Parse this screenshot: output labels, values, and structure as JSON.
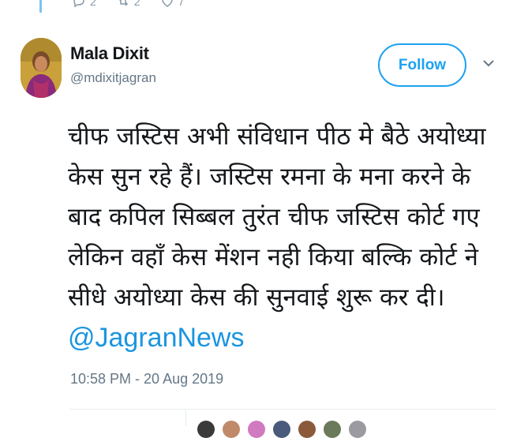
{
  "previous_tweet": {
    "replies": "2",
    "retweets": "2",
    "likes": "7"
  },
  "tweet": {
    "display_name": "Mala Dixit",
    "handle": "@mdixitjagran",
    "follow_label": "Follow",
    "text": "चीफ जस्टिस अभी संविधान पीठ मे बैठे अयोध्या केस सुन रहे हैं। जस्टिस रमना के मना करने के बाद कपिल सिब्बल तुरंत चीफ जस्टिस कोर्ट गए लेकिन वहाँ केस मेंशन नही किया बल्कि कोर्ट ने सीधे अयोध्या केस की सुनवाई शुरू कर दी।",
    "mention": "@JagranNews",
    "timestamp": "10:58 PM - 20 Aug 2019"
  },
  "colors": {
    "accent": "#1da1f2",
    "link": "#1b95e0",
    "secondary_text": "#657786"
  },
  "icons": [
    "reply-icon",
    "retweet-icon",
    "like-icon",
    "caret-down-icon"
  ]
}
